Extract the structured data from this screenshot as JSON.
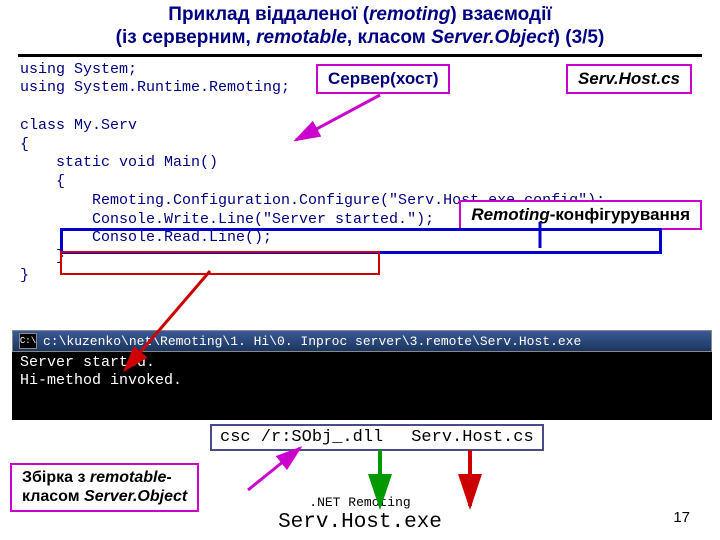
{
  "title": {
    "line1_a": "Приклад віддаленої (",
    "line1_b": "remoting",
    "line1_c": ") взаємодії",
    "line2_a": "(із серверним, ",
    "line2_b": "remotable",
    "line2_c": ",  класом ",
    "line2_d": "Server.Object",
    "line2_e": ") (3/5)"
  },
  "labels": {
    "server": "Сервер(хост)",
    "file": "Serv.Host.cs",
    "remoting_it": "Remoting",
    "remoting_rest": "-конфігурування"
  },
  "code": "using System;\nusing System.Runtime.Remoting;\n\nclass My.Serv\n{\n    static void Main()\n    {\n        Remoting.Configuration.Configure(\"Serv.Host.exe.config\");\n        Console.Write.Line(\"Server started.\");\n        Console.Read.Line();\n    }\n}",
  "console": {
    "title": "c:\\kuzenko\\net\\Remoting\\1. Hi\\0. Inproc server\\3.remote\\Serv.Host.exe",
    "body": "Server started.\nHi-method invoked."
  },
  "cmd": {
    "left": "csc /r:SObj_.dll",
    "right": "Serv.Host.cs"
  },
  "assembly": {
    "l1a": "Збірка з ",
    "l1b": "remotable",
    "l1c": "-",
    "l2a": "класом ",
    "l2b": "Server.Object"
  },
  "footer": {
    "small": ".NET Remoting",
    "big": "Serv.Host.exe"
  },
  "page": "17"
}
